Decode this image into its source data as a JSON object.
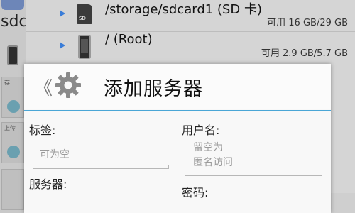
{
  "left_panel": {
    "drive_label": "sdca",
    "tile1_text": "存",
    "tile2_text": "上传"
  },
  "file_list": [
    {
      "name": "/storage/sdcard1 (SD 卡)",
      "size": "可用 16 GB/29 GB",
      "icon": "sd-card-icon"
    },
    {
      "name": "/ (Root)",
      "size": "可用 2.9 GB/5.7 GB",
      "icon": "phone-icon"
    }
  ],
  "dialog": {
    "back_glyph": "《",
    "title": "添加服务器",
    "accent": "#4aa6d6",
    "fields": {
      "label_label": "标签:",
      "label_placeholder": "可为空",
      "username_label": "用户名:",
      "username_placeholder": "留空为\n匿名访问",
      "server_label": "服务器:",
      "password_label": "密码:"
    }
  }
}
